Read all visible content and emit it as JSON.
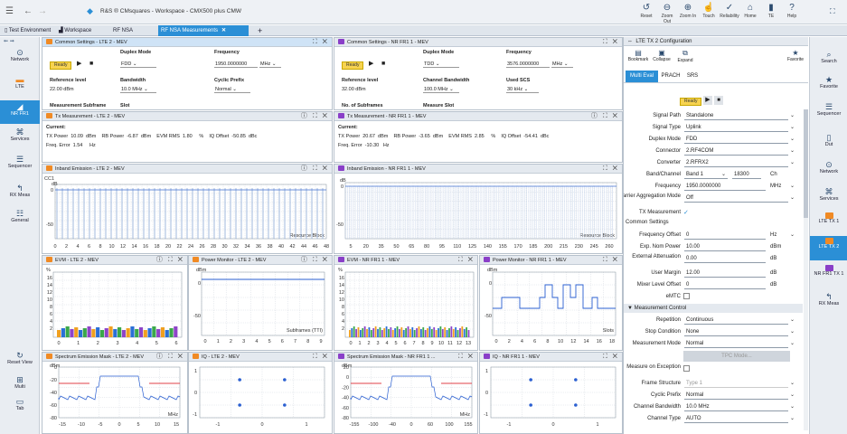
{
  "window": {
    "title": "R&S ® CMsquares - Workspace - CMX500 plus CMW"
  },
  "toolbar": {
    "tools": [
      {
        "label": "Reset",
        "icon": "reset-icon"
      },
      {
        "label": "Zoom Out",
        "icon": "zoom-out-icon"
      },
      {
        "label": "Zoom In",
        "icon": "zoom-in-icon"
      },
      {
        "label": "Touch",
        "icon": "touch-icon"
      },
      {
        "label": "Reliability",
        "icon": "reliability-icon"
      },
      {
        "label": "Home",
        "icon": "home-icon"
      },
      {
        "label": "TE",
        "icon": "te-icon"
      },
      {
        "label": "Help",
        "icon": "help-icon"
      }
    ]
  },
  "tabs": [
    {
      "label": "Test Environment",
      "icon": "test-environment-icon",
      "active": false,
      "closable": false
    },
    {
      "label": "Workspace",
      "icon": "workspace-icon",
      "active": false,
      "closable": false
    },
    {
      "label": "RF NSA Signaling",
      "icon": "",
      "active": false,
      "closable": true
    },
    {
      "label": "RF NSA Measurements",
      "icon": "",
      "active": true,
      "closable": true
    }
  ],
  "left_nav": [
    {
      "label": "Network",
      "icon": "network-icon",
      "active": false
    },
    {
      "label": "LTE",
      "icon": "lte-icon",
      "active": false
    },
    {
      "label": "NR FR1",
      "icon": "nr-fr1-icon",
      "active": true
    },
    {
      "label": "Services",
      "icon": "services-icon",
      "active": false
    },
    {
      "label": "Sequencer",
      "icon": "sequencer-icon",
      "active": false
    },
    {
      "label": "RX Meas",
      "icon": "rx-meas-icon",
      "active": false
    },
    {
      "label": "General",
      "icon": "general-icon",
      "active": false
    },
    {
      "label": "Reset View",
      "icon": "reset-view-icon",
      "active": false
    },
    {
      "label": "Multi",
      "icon": "multi-icon",
      "active": false
    },
    {
      "label": "Tab",
      "icon": "tab-icon",
      "active": false
    }
  ],
  "common_lte": {
    "title": "Common Settings - LTE 2 - MEV",
    "state": "Ready",
    "duplex_mode_label": "Duplex Mode",
    "duplex_mode": "FDD",
    "frequency_label": "Frequency",
    "frequency": "1950.0000000",
    "frequency_unit": "MHz",
    "ref_level_label": "Reference level",
    "ref_level": "22.00 dBm",
    "bandwidth_label": "Bandwidth",
    "bandwidth": "10.0 MHz",
    "cyclic_prefix_label": "Cyclic Prefix",
    "cyclic_prefix": "Normal",
    "meas_subframe_label": "Measurement Subframe",
    "slot_label": "Slot"
  },
  "common_nr": {
    "title": "Common Settings - NR FR1 1 - MEV",
    "state": "Ready",
    "duplex_mode_label": "Duplex Mode",
    "duplex_mode": "TDD",
    "frequency_label": "Frequency",
    "frequency": "3576.0000000",
    "frequency_unit": "MHz",
    "ref_level_label": "Reference level",
    "ref_level": "32.00 dBm",
    "channel_bw_label": "Channel Bandwidth",
    "channel_bw": "100.0 MHz",
    "used_scs_label": "Used SCS",
    "used_scs": "30 kHz",
    "num_subframes_label": "No. of Subframes",
    "meas_slot_label": "Measure Slot"
  },
  "tx_lte": {
    "title": "Tx Measurement - LTE 2 - MEV",
    "current_label": "Current:",
    "line1": "TX Power  10.09  dBm    RB Power  -6.87  dBm    EVM RMS  1.80     %    IQ Offset  -50.85  dBc",
    "line2": "Freq. Error  1.54     Hz"
  },
  "tx_nr": {
    "title": "Tx Measurement - NR FR1 1 - MEV",
    "current_label": "Current:",
    "line1": "TX Power  20.67  dBm    RB Power  -3.65  dBm    EVM RMS  2.85     %    IQ Offset  -54.41  dBc",
    "line2": "Freq. Error  -10.30   Hz"
  },
  "inband_lte": {
    "title": "Inband Emission - LTE 2 - MEV",
    "ylabel": "dB",
    "legend": "CC1",
    "y_ticks": [
      "0",
      "-50"
    ],
    "x_ticks": [
      "0",
      "2",
      "4",
      "6",
      "8",
      "10",
      "12",
      "14",
      "16",
      "18",
      "20",
      "22",
      "24",
      "26",
      "28",
      "30",
      "32",
      "34",
      "36",
      "38",
      "40",
      "42",
      "44",
      "46",
      "48"
    ],
    "xlabel": "Resource Block"
  },
  "inband_nr": {
    "title": "Inband Emission - NR FR1 1 - MEV",
    "ylabel": "dB",
    "y_ticks": [
      "0",
      "-50"
    ],
    "x_ticks": [
      "5",
      "20",
      "35",
      "50",
      "65",
      "80",
      "95",
      "110",
      "125",
      "140",
      "155",
      "170",
      "185",
      "200",
      "215",
      "230",
      "245",
      "260"
    ],
    "xlabel": "Resource Block"
  },
  "evm_lte": {
    "title": "EVM - LTE 2 - MEV",
    "ylabel": "%",
    "y_ticks": [
      "16",
      "14",
      "12",
      "10",
      "8",
      "6",
      "4",
      "2"
    ],
    "x_ticks": [
      "0",
      "1",
      "2",
      "3",
      "4",
      "5",
      "6"
    ]
  },
  "power_lte": {
    "title": "Power Monitor - LTE 2 - MEV",
    "ylabel": "dBm",
    "y_ticks": [
      "0",
      "-50"
    ],
    "x_ticks": [
      "0",
      "1",
      "2",
      "3",
      "4",
      "5",
      "6",
      "7",
      "8",
      "9"
    ],
    "xlabel": "Subframes (TTI)"
  },
  "evm_nr": {
    "title": "EVM - NR FR1 1 - MEV",
    "ylabel": "%",
    "y_ticks": [
      "16",
      "14",
      "12",
      "10",
      "8",
      "6",
      "4",
      "2"
    ],
    "x_ticks": [
      "0",
      "1",
      "2",
      "3",
      "4",
      "5",
      "6",
      "7",
      "8",
      "9",
      "10",
      "11",
      "12",
      "13"
    ]
  },
  "power_nr": {
    "title": "Power Monitor - NR FR1 1 - MEV",
    "ylabel": "dBm",
    "y_ticks": [
      "0",
      "-50"
    ],
    "x_ticks": [
      "0",
      "2",
      "4",
      "6",
      "8",
      "10",
      "12",
      "14",
      "16",
      "18"
    ],
    "xlabel": "Slots"
  },
  "sem_lte": {
    "title": "Spectrum Emission Mask - LTE 2 - MEV",
    "ylabel": "dBm",
    "y_ticks": [
      "0",
      "-20",
      "-40",
      "-60",
      "-80"
    ],
    "x_ticks": [
      "-15",
      "-10",
      "-5",
      "0",
      "5",
      "10",
      "15"
    ],
    "xlabel": "MHz"
  },
  "iq_lte": {
    "title": "IQ - LTE 2 - MEV",
    "y_ticks": [
      "1",
      "0",
      "-1"
    ],
    "x_ticks": [
      "-1",
      "0",
      "1"
    ]
  },
  "sem_nr": {
    "title": "Spectrum Emission Mask - NR FR1 1 ...",
    "ylabel": "dBm",
    "y_ticks": [
      "20",
      "0",
      "-20",
      "-40",
      "-60",
      "-80"
    ],
    "x_ticks": [
      "-155",
      "-100",
      "-40",
      "0",
      "60",
      "100",
      "155"
    ],
    "xlabel": "MHz"
  },
  "iq_nr": {
    "title": "IQ - NR FR1 1 - MEV",
    "y_ticks": [
      "1",
      "0",
      "-1"
    ],
    "x_ticks": [
      "-1",
      "0",
      "1"
    ]
  },
  "config": {
    "title": "LTE TX 2 Configuration",
    "bookmark": "Bookmark",
    "collapse": "Collapse",
    "expand": "Expand",
    "favorite": "Favorite",
    "tabs": [
      "Multi Eval",
      "PRACH",
      "SRS"
    ],
    "state": "Ready",
    "rows": [
      {
        "label": "Signal Path",
        "value": "Standalone",
        "unit": "",
        "dropdown": true
      },
      {
        "label": "Signal Type",
        "value": "Uplink",
        "unit": "",
        "dropdown": true
      },
      {
        "label": "Duplex Mode",
        "value": "FDD",
        "unit": "",
        "dropdown": true
      },
      {
        "label": "Connector",
        "value": "2.RF4COM",
        "unit": "",
        "dropdown": true
      },
      {
        "label": "Converter",
        "value": "2.RFRX2",
        "unit": "",
        "dropdown": true
      },
      {
        "label": "Band/Channel",
        "value": "Band 1",
        "value2": "18300",
        "unit": "Ch",
        "dropdown": false
      },
      {
        "label": "Frequency",
        "value": "1950.0000000",
        "unit": "MHz",
        "dropdown": true
      },
      {
        "label": "Carrier Aggregation Mode",
        "value": "Off",
        "unit": "",
        "dropdown": true
      },
      {
        "label": "TX Measurement",
        "value": "✓",
        "unit": "",
        "dropdown": false
      }
    ],
    "section_common": "Common Settings",
    "rows2": [
      {
        "label": "Frequency Offset",
        "value": "0",
        "unit": "Hz",
        "dropdown": true
      },
      {
        "label": "Exp. Nom Power",
        "value": "10.00",
        "unit": "dBm",
        "dropdown": false
      },
      {
        "label": "External Attenuation",
        "value": "0.00",
        "unit": "dB",
        "dropdown": false
      },
      {
        "label": "User Margin",
        "value": "12.00",
        "unit": "dB",
        "dropdown": false
      },
      {
        "label": "Mixer Level Offset",
        "value": "0",
        "unit": "dB",
        "dropdown": false
      },
      {
        "label": "eMTC",
        "value": "",
        "unit": "",
        "dropdown": false
      }
    ],
    "section_meas": "Measurement Control",
    "rows3": [
      {
        "label": "Repetition",
        "value": "Continuous",
        "unit": "",
        "dropdown": true
      },
      {
        "label": "Stop Condition",
        "value": "None",
        "unit": "",
        "dropdown": true
      },
      {
        "label": "Measurement Mode",
        "value": "Normal",
        "unit": "",
        "dropdown": true
      }
    ],
    "tpc_mode": "TPC Mode...",
    "rows4": [
      {
        "label": "Measure on Exception",
        "value": "",
        "unit": "",
        "dropdown": false
      },
      {
        "label": "Frame Structure",
        "value": "Type 1",
        "unit": "",
        "dropdown": true
      },
      {
        "label": "Cyclic Prefix",
        "value": "Normal",
        "unit": "",
        "dropdown": true
      },
      {
        "label": "Channel Bandwidth",
        "value": "10.0 MHz",
        "unit": "",
        "dropdown": true
      },
      {
        "label": "Channel Type",
        "value": "AUTO",
        "unit": "",
        "dropdown": true
      }
    ]
  },
  "right_nav": [
    {
      "label": "Search",
      "icon": "search-icon",
      "active": false
    },
    {
      "label": "Favorite",
      "icon": "favorite-icon",
      "active": false
    },
    {
      "label": "Sequencer",
      "icon": "sequencer-icon",
      "active": false
    },
    {
      "label": "Dut",
      "icon": "dut-icon",
      "active": false
    },
    {
      "label": "Network",
      "icon": "network-icon",
      "active": false
    },
    {
      "label": "Services",
      "icon": "services-icon",
      "active": false
    },
    {
      "label": "LTE TX 1",
      "icon": "lte-tx-icon",
      "active": false
    },
    {
      "label": "LTE TX 2",
      "icon": "lte-tx-icon",
      "active": true
    },
    {
      "label": "NR FR1 TX 1",
      "icon": "nr-tx-icon",
      "active": false
    },
    {
      "label": "RX Meas",
      "icon": "rx-meas-icon",
      "active": false
    }
  ],
  "colors": {
    "accent": "#2b8fd6",
    "lte": "#f08a24",
    "nr": "#8a3fc8",
    "ready": "#f7d350",
    "trace": "#2a5fd1"
  }
}
